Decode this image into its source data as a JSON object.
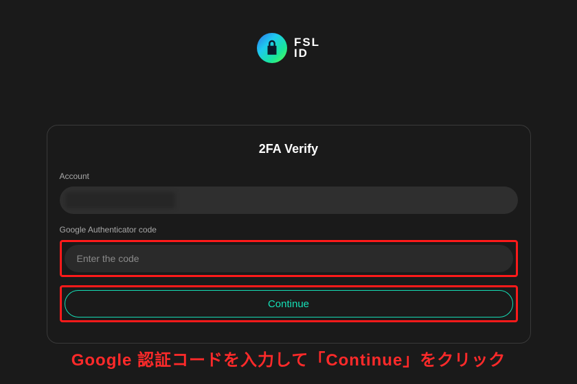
{
  "brand": {
    "line1": "FSL",
    "line2": "ID"
  },
  "card": {
    "title": "2FA Verify",
    "account_label": "Account",
    "code_label": "Google Authenticator code",
    "code_placeholder": "Enter the code",
    "continue_label": "Continue"
  },
  "caption": "Google 認証コードを入力して「Continue」をクリック",
  "colors": {
    "accent": "#15e0b7",
    "highlight": "#ff1a1a"
  }
}
